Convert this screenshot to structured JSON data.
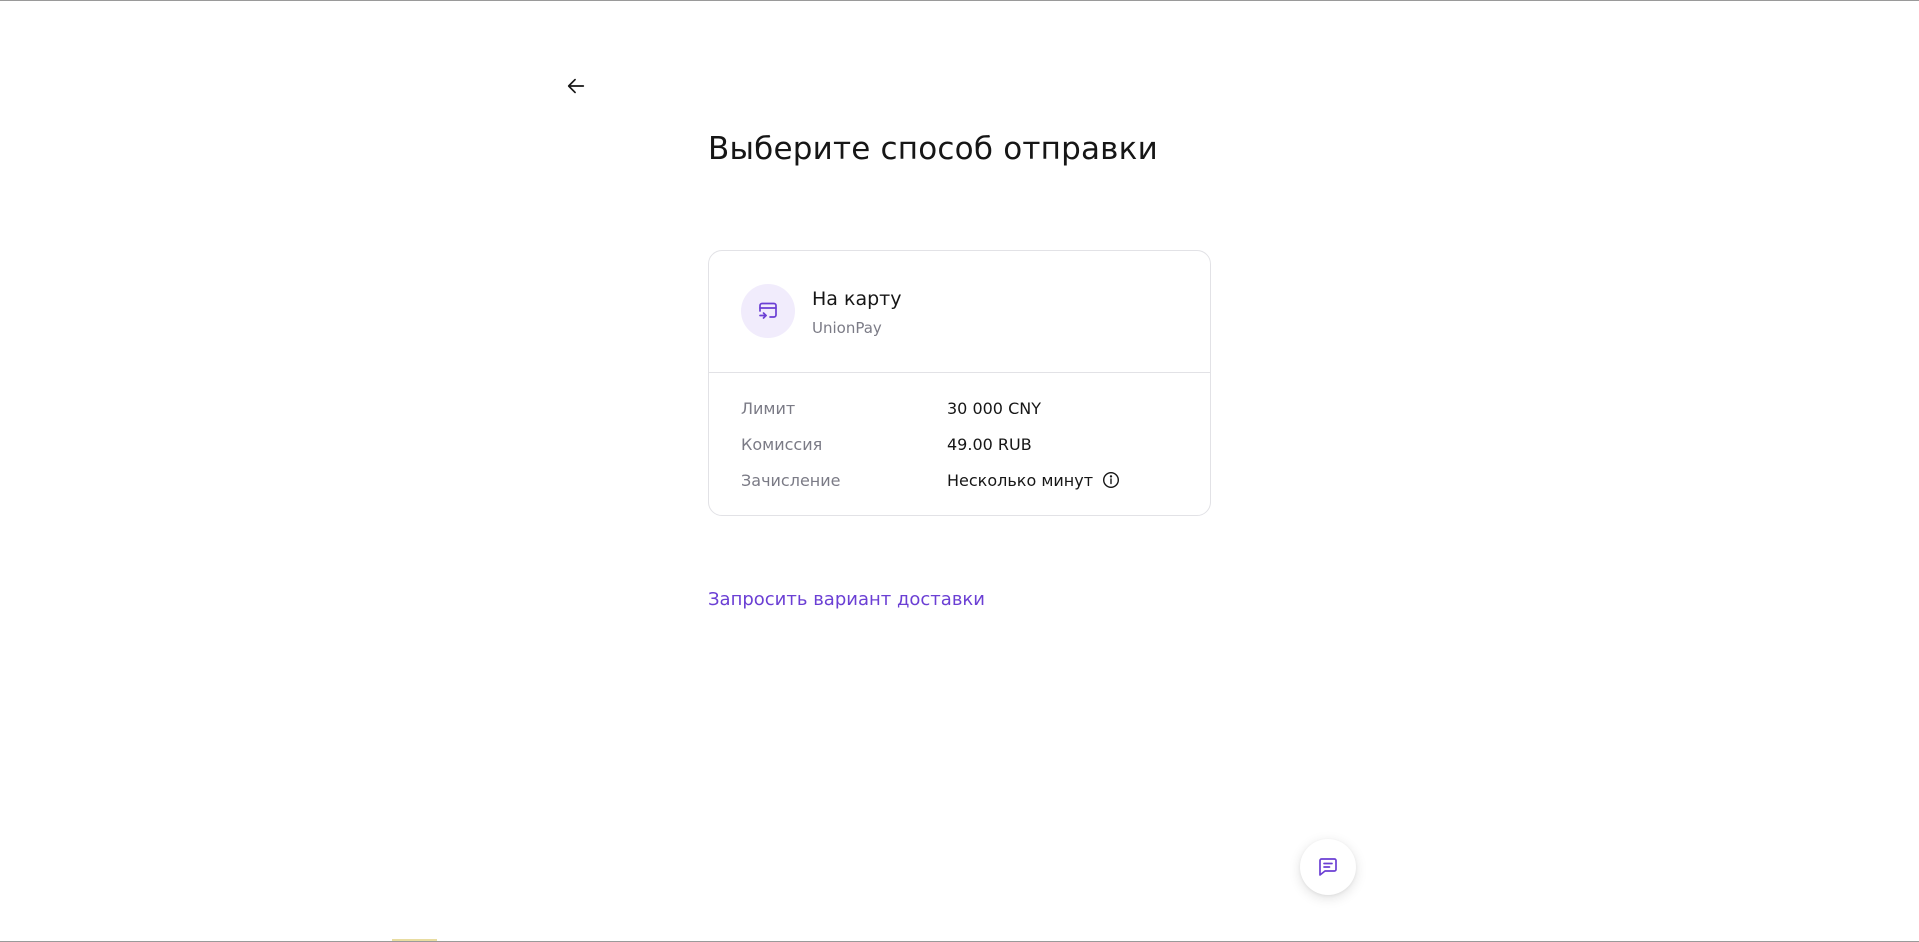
{
  "header": {
    "title": "Выберите способ отправки"
  },
  "method": {
    "title": "На карту",
    "subtitle": "UnionPay",
    "icon": "card-transfer-icon",
    "details": [
      {
        "label": "Лимит",
        "value": "30 000 CNY"
      },
      {
        "label": "Комиссия",
        "value": "49.00 RUB"
      },
      {
        "label": "Зачисление",
        "value": "Несколько минут"
      }
    ]
  },
  "request_link": {
    "label": "Запросить вариант доставки"
  },
  "colors": {
    "accent": "#6b3fd4",
    "icon_bg": "#f1ecfc",
    "muted_text": "#7b7b86",
    "border": "#e2e2e6"
  },
  "icons": {
    "back": "arrow-left-icon",
    "info": "info-icon",
    "chat": "chat-icon"
  }
}
